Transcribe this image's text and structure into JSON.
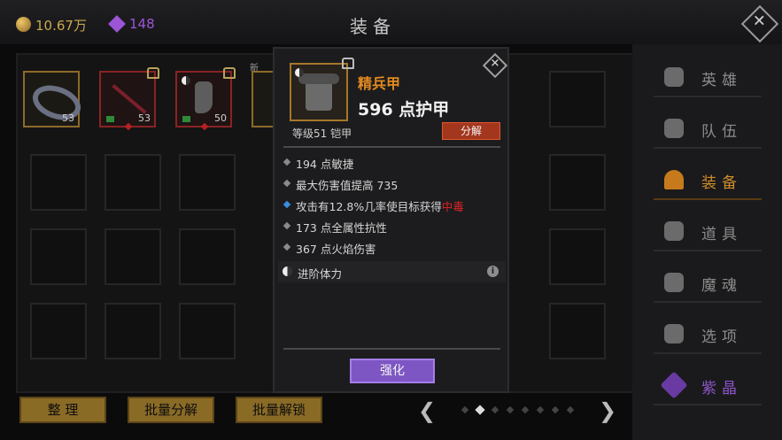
{
  "header": {
    "title": "装备",
    "gold": "10.67万",
    "gems": "148"
  },
  "inventory": {
    "new_label": "新",
    "items": [
      {
        "count": "53"
      },
      {
        "count": "53"
      },
      {
        "count": "50"
      }
    ]
  },
  "bottom": {
    "btn_sort": "整 理",
    "btn_batch_decompose": "批量分解",
    "btn_batch_unlock": "批量解锁",
    "pager_prev": "❮",
    "pager_next": "❯"
  },
  "nav": {
    "items": [
      {
        "label": "英雄"
      },
      {
        "label": "队伍"
      },
      {
        "label": "装备"
      },
      {
        "label": "道具"
      },
      {
        "label": "魔魂"
      },
      {
        "label": "选项"
      },
      {
        "label": "紫晶"
      }
    ],
    "active": "装备",
    "active_color": "#d08c2b",
    "purple_color": "#8d55c9"
  },
  "popup": {
    "name": "精兵甲",
    "armor": "596 点护甲",
    "level_type": "等级51 铠甲",
    "decompose": "分解",
    "stats": [
      {
        "text": "194 点敏捷"
      },
      {
        "text": "最大伤害值提高 735"
      },
      {
        "text": "攻击有12.8%几率使目标获得",
        "highlight": "中毒"
      },
      {
        "text": "173 点全属性抗性"
      },
      {
        "text": "367 点火焰伤害"
      }
    ],
    "advance": "进阶体力",
    "info_icon": "i",
    "strengthen": "强化",
    "name_color": "#e38a1f",
    "highlight_color": "#e02424"
  }
}
